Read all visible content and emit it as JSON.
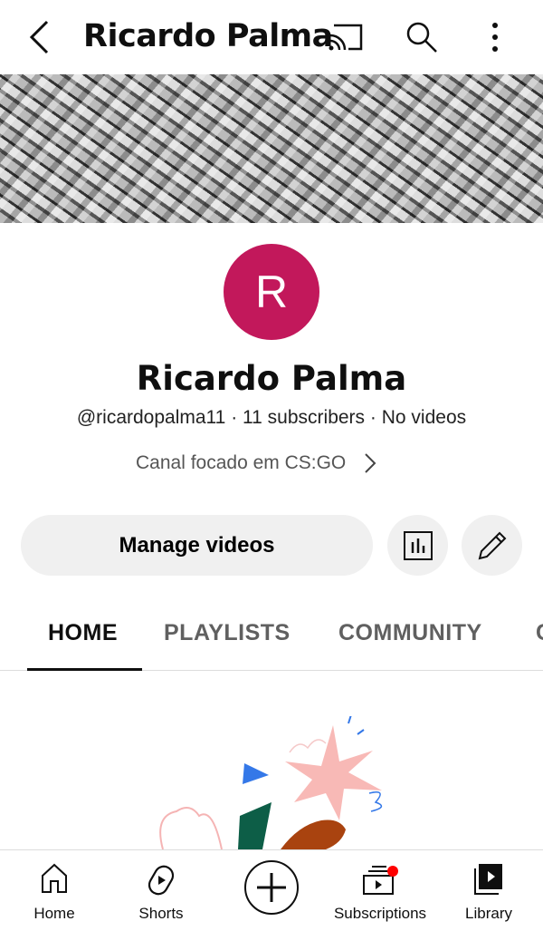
{
  "header": {
    "title": "Ricardo Palma"
  },
  "channel": {
    "avatar_letter": "R",
    "name": "Ricardo Palma",
    "handle": "@ricardopalma11",
    "subscribers": "11 subscribers",
    "videos": "No videos",
    "separator": "·",
    "description": "Canal focado em CS:GO",
    "avatar_color": "#c2185b"
  },
  "actions": {
    "manage_label": "Manage videos"
  },
  "tabs": [
    {
      "label": "HOME"
    },
    {
      "label": "PLAYLISTS"
    },
    {
      "label": "COMMUNITY"
    },
    {
      "label": "C"
    }
  ],
  "nav": [
    {
      "label": "Home"
    },
    {
      "label": "Shorts"
    },
    {
      "label": "Subscriptions"
    },
    {
      "label": "Library"
    }
  ]
}
